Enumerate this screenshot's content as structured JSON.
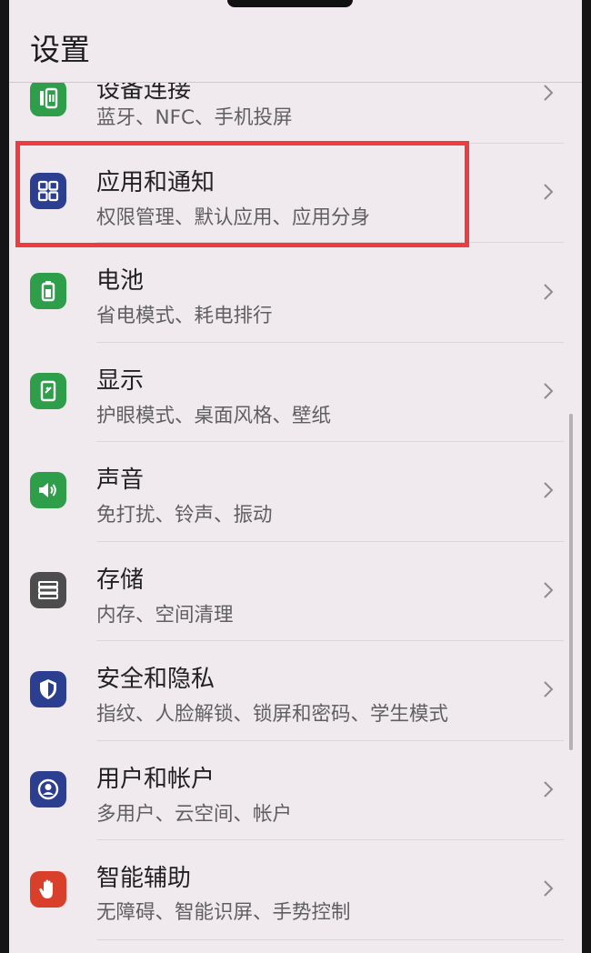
{
  "header": {
    "title": "设置"
  },
  "items": [
    {
      "title": "设备连接",
      "subtitle": "蓝牙、NFC、手机投屏",
      "icon": "device-connection-icon",
      "color": "#2e9e4a"
    },
    {
      "title": "应用和通知",
      "subtitle": "权限管理、默认应用、应用分身",
      "icon": "apps-grid-icon",
      "color": "#2c3e8f"
    },
    {
      "title": "电池",
      "subtitle": "省电模式、耗电排行",
      "icon": "battery-icon",
      "color": "#2e9e4a"
    },
    {
      "title": "显示",
      "subtitle": "护眼模式、桌面风格、壁纸",
      "icon": "display-icon",
      "color": "#2e9e4a"
    },
    {
      "title": "声音",
      "subtitle": "免打扰、铃声、振动",
      "icon": "speaker-icon",
      "color": "#2e9e4a"
    },
    {
      "title": "存储",
      "subtitle": "内存、空间清理",
      "icon": "storage-icon",
      "color": "#4d4d4d"
    },
    {
      "title": "安全和隐私",
      "subtitle": "指纹、人脸解锁、锁屏和密码、学生模式",
      "icon": "shield-icon",
      "color": "#2c3e8f"
    },
    {
      "title": "用户和帐户",
      "subtitle": "多用户、云空间、帐户",
      "icon": "user-account-icon",
      "color": "#2c3e8f"
    },
    {
      "title": "智能辅助",
      "subtitle": "无障碍、智能识屏、手势控制",
      "icon": "hand-icon",
      "color": "#d8402b"
    }
  ]
}
